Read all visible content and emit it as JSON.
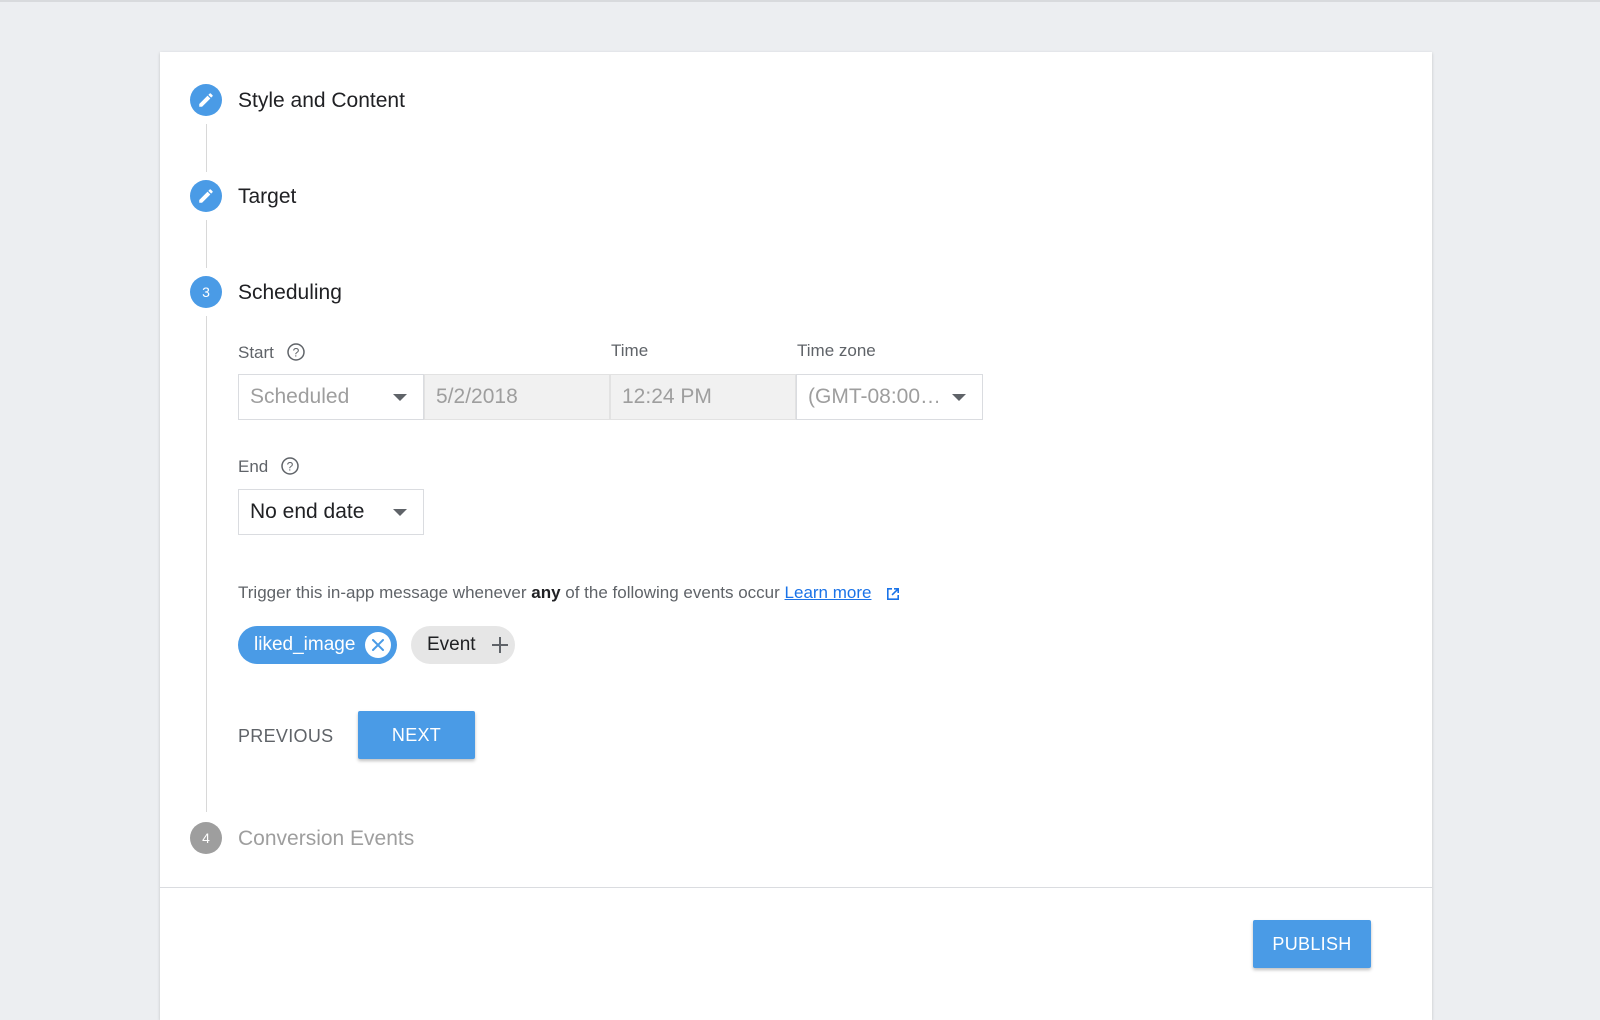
{
  "steps": [
    {
      "title": "Style and Content",
      "state": "done"
    },
    {
      "title": "Target",
      "state": "done"
    },
    {
      "number": "3",
      "title": "Scheduling",
      "state": "active"
    },
    {
      "number": "4",
      "title": "Conversion Events",
      "state": "pending"
    }
  ],
  "scheduling": {
    "start_label": "Start",
    "time_label": "Time",
    "timezone_label": "Time zone",
    "start_mode": "Scheduled",
    "date": "5/2/2018",
    "time": "12:24 PM",
    "timezone": "(GMT-08:00…",
    "end_label": "End",
    "end_mode": "No end date",
    "trigger_prefix": "Trigger this in-app message whenever",
    "trigger_bold": "any",
    "trigger_suffix": "of the following events occur",
    "learn_more": "Learn more",
    "event_chip": "liked_image",
    "add_event": "Event",
    "previous": "PREVIOUS",
    "next": "NEXT"
  },
  "footer": {
    "publish": "PUBLISH"
  },
  "colors": {
    "accent": "#4a9be6",
    "link": "#1a73e8",
    "inactive_step": "#9e9e9e"
  },
  "icons": {
    "done_step": "pencil-icon",
    "help": "help-circle-icon",
    "external": "external-link-icon",
    "remove_chip": "close-circle-icon",
    "add": "plus-icon",
    "dropdown": "caret-down-icon"
  }
}
